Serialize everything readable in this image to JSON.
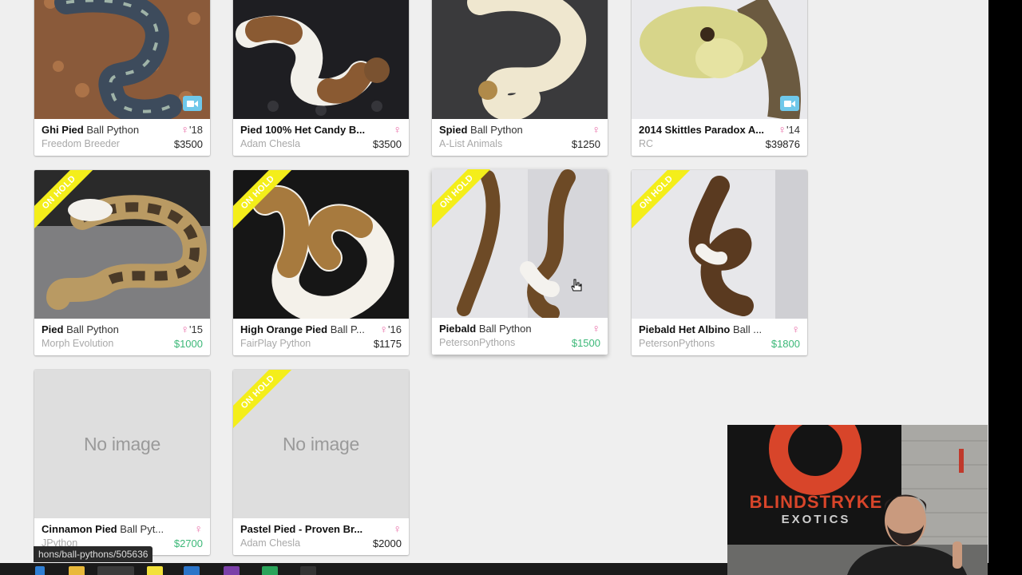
{
  "listings": [
    {
      "bold": "Ghi Pied",
      "rest": " Ball Python",
      "year": "'18",
      "seller": "Freedom Breeder",
      "price": "$3500",
      "price_green": false,
      "on_hold": false,
      "video": true,
      "image": "photo"
    },
    {
      "bold": "Pied 100% Het Candy B...",
      "rest": "",
      "year": "",
      "seller": "Adam Chesla",
      "price": "$3500",
      "price_green": false,
      "on_hold": false,
      "video": false,
      "image": "photo"
    },
    {
      "bold": "Spied",
      "rest": " Ball Python",
      "year": "",
      "seller": "A-List Animals",
      "price": "$1250",
      "price_green": false,
      "on_hold": false,
      "video": false,
      "image": "photo"
    },
    {
      "bold": "2014 Skittles Paradox A...",
      "rest": "",
      "year": "'14",
      "seller": "RC",
      "price": "$39876",
      "price_green": false,
      "on_hold": false,
      "video": true,
      "image": "photo"
    },
    {
      "bold": "Pied",
      "rest": " Ball Python",
      "year": "'15",
      "seller": "Morph Evolution",
      "price": "$1000",
      "price_green": true,
      "on_hold": true,
      "video": false,
      "image": "photo"
    },
    {
      "bold": "High Orange Pied",
      "rest": " Ball P...",
      "year": "'16",
      "seller": "FairPlay Python",
      "price": "$1175",
      "price_green": false,
      "on_hold": true,
      "video": false,
      "image": "photo"
    },
    {
      "bold": "Piebald",
      "rest": " Ball Python",
      "year": "",
      "seller": "PetersonPythons",
      "price": "$1500",
      "price_green": true,
      "on_hold": true,
      "video": false,
      "image": "photo"
    },
    {
      "bold": "Piebald Het Albino",
      "rest": " Ball ...",
      "year": "",
      "seller": "PetersonPythons",
      "price": "$1800",
      "price_green": true,
      "on_hold": true,
      "video": false,
      "image": "photo"
    },
    {
      "bold": "Cinnamon Pied",
      "rest": " Ball Pyt...",
      "year": "",
      "seller": "JPython",
      "price": "$2700",
      "price_green": true,
      "on_hold": false,
      "video": false,
      "image": "none"
    },
    {
      "bold": "Pastel Pied - Proven Br...",
      "rest": "",
      "year": "",
      "seller": "Adam Chesla",
      "price": "$2000",
      "price_green": false,
      "on_hold": true,
      "video": false,
      "image": "none"
    }
  ],
  "labels": {
    "on_hold": "ON HOLD",
    "no_image": "No image",
    "female_symbol": "♀"
  },
  "status_url": "hons/ball-pythons/505636",
  "webcam": {
    "banner_line1": "BLINDSTRYKE",
    "banner_line2": "EXOTICS"
  },
  "colors": {
    "page_bg": "#efefef",
    "on_hold_ribbon": "#f4ee1a",
    "female": "#e86aa6",
    "price_green": "#3cb878",
    "video_badge": "#6fc8ea"
  },
  "icons": [
    "female-icon",
    "video-camera-icon",
    "hand-cursor-icon"
  ]
}
